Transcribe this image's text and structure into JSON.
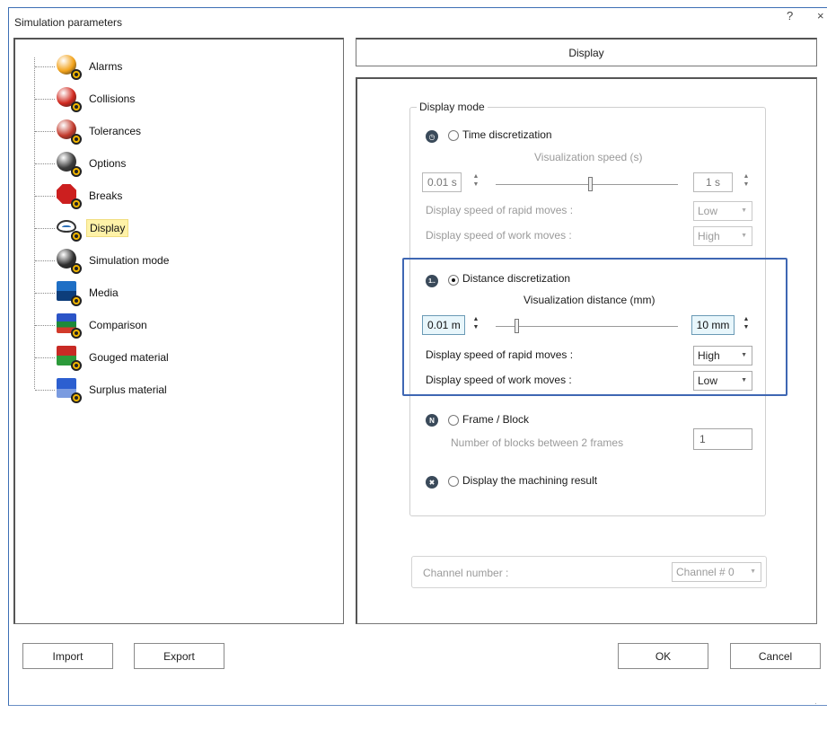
{
  "window": {
    "title": "Simulation parameters",
    "help_glyph": "?",
    "close_glyph": "×"
  },
  "tree": {
    "items": [
      {
        "label": "Alarms",
        "icon": "alarms-icon",
        "color": "#f2a21a",
        "selected": false
      },
      {
        "label": "Collisions",
        "icon": "collisions-icon",
        "color": "#d0281e",
        "selected": false
      },
      {
        "label": "Tolerances",
        "icon": "tolerances-icon",
        "color": "#c23a2c",
        "selected": false
      },
      {
        "label": "Options",
        "icon": "options-icon",
        "color": "#3c3c3c",
        "selected": false
      },
      {
        "label": "Breaks",
        "icon": "breaks-icon",
        "color": "#cc1f1f",
        "selected": false
      },
      {
        "label": "Display",
        "icon": "eye-icon",
        "color": "#2a6fb8",
        "selected": true
      },
      {
        "label": "Simulation mode",
        "icon": "play-icon",
        "color": "#2f2f2f",
        "selected": false
      },
      {
        "label": "Media",
        "icon": "media-icon",
        "color": "#2a6fb8",
        "selected": false
      },
      {
        "label": "Comparison",
        "icon": "comparison-icon",
        "color": "#2b54c7",
        "selected": false
      },
      {
        "label": "Gouged material",
        "icon": "gouged-material-icon",
        "color": "#c82a25",
        "selected": false
      },
      {
        "label": "Surplus material",
        "icon": "surplus-material-icon",
        "color": "#2c5fd0",
        "selected": false
      }
    ]
  },
  "panel": {
    "tab_title": "Display",
    "display_mode_legend": "Display mode",
    "time": {
      "radio_label": "Time discretization",
      "checked": false,
      "speed_label": "Visualization speed (s)",
      "min_value": "0.01 s",
      "max_value": "1 s",
      "slider_fraction": 0.52,
      "rapid_label": "Display speed of rapid moves :",
      "rapid_value": "Low",
      "work_label": "Display speed of work moves :",
      "work_value": "High"
    },
    "distance": {
      "radio_label": "Distance discretization",
      "checked": true,
      "distance_label": "Visualization distance (mm)",
      "min_value": "0.01 m",
      "max_value": "10 mm",
      "slider_fraction": 0.12,
      "rapid_label": "Display speed of rapid moves :",
      "rapid_value": "High",
      "work_label": "Display speed of work moves :",
      "work_value": "Low"
    },
    "frame": {
      "radio_label": "Frame / Block",
      "icon_letter": "N",
      "blocks_label": "Number of blocks between 2 frames",
      "blocks_value": "1"
    },
    "result": {
      "radio_label": "Display the machining result"
    },
    "channel": {
      "label": "Channel number :",
      "value": "Channel # 0"
    }
  },
  "buttons": {
    "import": "Import",
    "export": "Export",
    "ok": "OK",
    "cancel": "Cancel"
  },
  "colors": {
    "highlight": "#3f67b3",
    "selected_bg": "#fff2a8",
    "active_field_bg": "#e8f6fb"
  }
}
